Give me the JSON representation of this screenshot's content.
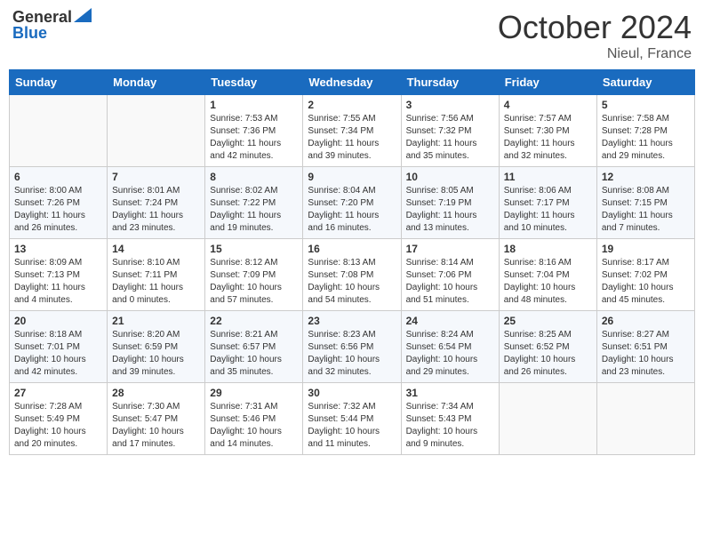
{
  "header": {
    "logo_general": "General",
    "logo_blue": "Blue",
    "month_title": "October 2024",
    "location": "Nieul, France"
  },
  "days_of_week": [
    "Sunday",
    "Monday",
    "Tuesday",
    "Wednesday",
    "Thursday",
    "Friday",
    "Saturday"
  ],
  "weeks": [
    [
      {
        "day": "",
        "sunrise": "",
        "sunset": "",
        "daylight": ""
      },
      {
        "day": "",
        "sunrise": "",
        "sunset": "",
        "daylight": ""
      },
      {
        "day": "1",
        "sunrise": "Sunrise: 7:53 AM",
        "sunset": "Sunset: 7:36 PM",
        "daylight": "Daylight: 11 hours and 42 minutes."
      },
      {
        "day": "2",
        "sunrise": "Sunrise: 7:55 AM",
        "sunset": "Sunset: 7:34 PM",
        "daylight": "Daylight: 11 hours and 39 minutes."
      },
      {
        "day": "3",
        "sunrise": "Sunrise: 7:56 AM",
        "sunset": "Sunset: 7:32 PM",
        "daylight": "Daylight: 11 hours and 35 minutes."
      },
      {
        "day": "4",
        "sunrise": "Sunrise: 7:57 AM",
        "sunset": "Sunset: 7:30 PM",
        "daylight": "Daylight: 11 hours and 32 minutes."
      },
      {
        "day": "5",
        "sunrise": "Sunrise: 7:58 AM",
        "sunset": "Sunset: 7:28 PM",
        "daylight": "Daylight: 11 hours and 29 minutes."
      }
    ],
    [
      {
        "day": "6",
        "sunrise": "Sunrise: 8:00 AM",
        "sunset": "Sunset: 7:26 PM",
        "daylight": "Daylight: 11 hours and 26 minutes."
      },
      {
        "day": "7",
        "sunrise": "Sunrise: 8:01 AM",
        "sunset": "Sunset: 7:24 PM",
        "daylight": "Daylight: 11 hours and 23 minutes."
      },
      {
        "day": "8",
        "sunrise": "Sunrise: 8:02 AM",
        "sunset": "Sunset: 7:22 PM",
        "daylight": "Daylight: 11 hours and 19 minutes."
      },
      {
        "day": "9",
        "sunrise": "Sunrise: 8:04 AM",
        "sunset": "Sunset: 7:20 PM",
        "daylight": "Daylight: 11 hours and 16 minutes."
      },
      {
        "day": "10",
        "sunrise": "Sunrise: 8:05 AM",
        "sunset": "Sunset: 7:19 PM",
        "daylight": "Daylight: 11 hours and 13 minutes."
      },
      {
        "day": "11",
        "sunrise": "Sunrise: 8:06 AM",
        "sunset": "Sunset: 7:17 PM",
        "daylight": "Daylight: 11 hours and 10 minutes."
      },
      {
        "day": "12",
        "sunrise": "Sunrise: 8:08 AM",
        "sunset": "Sunset: 7:15 PM",
        "daylight": "Daylight: 11 hours and 7 minutes."
      }
    ],
    [
      {
        "day": "13",
        "sunrise": "Sunrise: 8:09 AM",
        "sunset": "Sunset: 7:13 PM",
        "daylight": "Daylight: 11 hours and 4 minutes."
      },
      {
        "day": "14",
        "sunrise": "Sunrise: 8:10 AM",
        "sunset": "Sunset: 7:11 PM",
        "daylight": "Daylight: 11 hours and 0 minutes."
      },
      {
        "day": "15",
        "sunrise": "Sunrise: 8:12 AM",
        "sunset": "Sunset: 7:09 PM",
        "daylight": "Daylight: 10 hours and 57 minutes."
      },
      {
        "day": "16",
        "sunrise": "Sunrise: 8:13 AM",
        "sunset": "Sunset: 7:08 PM",
        "daylight": "Daylight: 10 hours and 54 minutes."
      },
      {
        "day": "17",
        "sunrise": "Sunrise: 8:14 AM",
        "sunset": "Sunset: 7:06 PM",
        "daylight": "Daylight: 10 hours and 51 minutes."
      },
      {
        "day": "18",
        "sunrise": "Sunrise: 8:16 AM",
        "sunset": "Sunset: 7:04 PM",
        "daylight": "Daylight: 10 hours and 48 minutes."
      },
      {
        "day": "19",
        "sunrise": "Sunrise: 8:17 AM",
        "sunset": "Sunset: 7:02 PM",
        "daylight": "Daylight: 10 hours and 45 minutes."
      }
    ],
    [
      {
        "day": "20",
        "sunrise": "Sunrise: 8:18 AM",
        "sunset": "Sunset: 7:01 PM",
        "daylight": "Daylight: 10 hours and 42 minutes."
      },
      {
        "day": "21",
        "sunrise": "Sunrise: 8:20 AM",
        "sunset": "Sunset: 6:59 PM",
        "daylight": "Daylight: 10 hours and 39 minutes."
      },
      {
        "day": "22",
        "sunrise": "Sunrise: 8:21 AM",
        "sunset": "Sunset: 6:57 PM",
        "daylight": "Daylight: 10 hours and 35 minutes."
      },
      {
        "day": "23",
        "sunrise": "Sunrise: 8:23 AM",
        "sunset": "Sunset: 6:56 PM",
        "daylight": "Daylight: 10 hours and 32 minutes."
      },
      {
        "day": "24",
        "sunrise": "Sunrise: 8:24 AM",
        "sunset": "Sunset: 6:54 PM",
        "daylight": "Daylight: 10 hours and 29 minutes."
      },
      {
        "day": "25",
        "sunrise": "Sunrise: 8:25 AM",
        "sunset": "Sunset: 6:52 PM",
        "daylight": "Daylight: 10 hours and 26 minutes."
      },
      {
        "day": "26",
        "sunrise": "Sunrise: 8:27 AM",
        "sunset": "Sunset: 6:51 PM",
        "daylight": "Daylight: 10 hours and 23 minutes."
      }
    ],
    [
      {
        "day": "27",
        "sunrise": "Sunrise: 7:28 AM",
        "sunset": "Sunset: 5:49 PM",
        "daylight": "Daylight: 10 hours and 20 minutes."
      },
      {
        "day": "28",
        "sunrise": "Sunrise: 7:30 AM",
        "sunset": "Sunset: 5:47 PM",
        "daylight": "Daylight: 10 hours and 17 minutes."
      },
      {
        "day": "29",
        "sunrise": "Sunrise: 7:31 AM",
        "sunset": "Sunset: 5:46 PM",
        "daylight": "Daylight: 10 hours and 14 minutes."
      },
      {
        "day": "30",
        "sunrise": "Sunrise: 7:32 AM",
        "sunset": "Sunset: 5:44 PM",
        "daylight": "Daylight: 10 hours and 11 minutes."
      },
      {
        "day": "31",
        "sunrise": "Sunrise: 7:34 AM",
        "sunset": "Sunset: 5:43 PM",
        "daylight": "Daylight: 10 hours and 9 minutes."
      },
      {
        "day": "",
        "sunrise": "",
        "sunset": "",
        "daylight": ""
      },
      {
        "day": "",
        "sunrise": "",
        "sunset": "",
        "daylight": ""
      }
    ]
  ]
}
